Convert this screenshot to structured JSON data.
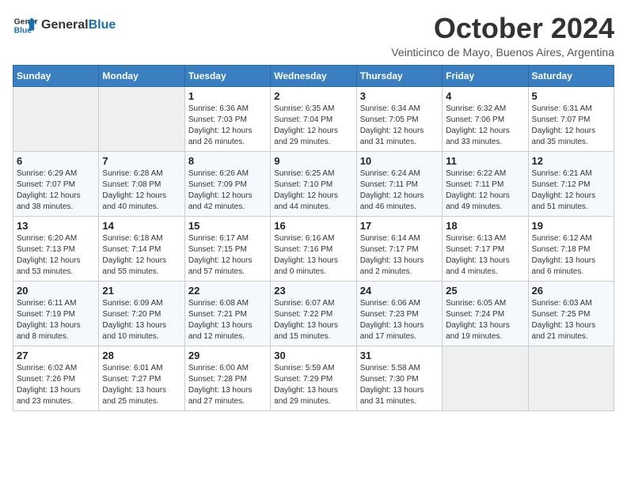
{
  "header": {
    "logo_general": "General",
    "logo_blue": "Blue",
    "month_title": "October 2024",
    "subtitle": "Veinticinco de Mayo, Buenos Aires, Argentina"
  },
  "days_of_week": [
    "Sunday",
    "Monday",
    "Tuesday",
    "Wednesday",
    "Thursday",
    "Friday",
    "Saturday"
  ],
  "weeks": [
    [
      {
        "day": "",
        "empty": true
      },
      {
        "day": "",
        "empty": true
      },
      {
        "day": "1",
        "sunrise": "6:36 AM",
        "sunset": "7:03 PM",
        "daylight": "12 hours and 26 minutes."
      },
      {
        "day": "2",
        "sunrise": "6:35 AM",
        "sunset": "7:04 PM",
        "daylight": "12 hours and 29 minutes."
      },
      {
        "day": "3",
        "sunrise": "6:34 AM",
        "sunset": "7:05 PM",
        "daylight": "12 hours and 31 minutes."
      },
      {
        "day": "4",
        "sunrise": "6:32 AM",
        "sunset": "7:06 PM",
        "daylight": "12 hours and 33 minutes."
      },
      {
        "day": "5",
        "sunrise": "6:31 AM",
        "sunset": "7:07 PM",
        "daylight": "12 hours and 35 minutes."
      }
    ],
    [
      {
        "day": "6",
        "sunrise": "6:29 AM",
        "sunset": "7:07 PM",
        "daylight": "12 hours and 38 minutes."
      },
      {
        "day": "7",
        "sunrise": "6:28 AM",
        "sunset": "7:08 PM",
        "daylight": "12 hours and 40 minutes."
      },
      {
        "day": "8",
        "sunrise": "6:26 AM",
        "sunset": "7:09 PM",
        "daylight": "12 hours and 42 minutes."
      },
      {
        "day": "9",
        "sunrise": "6:25 AM",
        "sunset": "7:10 PM",
        "daylight": "12 hours and 44 minutes."
      },
      {
        "day": "10",
        "sunrise": "6:24 AM",
        "sunset": "7:11 PM",
        "daylight": "12 hours and 46 minutes."
      },
      {
        "day": "11",
        "sunrise": "6:22 AM",
        "sunset": "7:11 PM",
        "daylight": "12 hours and 49 minutes."
      },
      {
        "day": "12",
        "sunrise": "6:21 AM",
        "sunset": "7:12 PM",
        "daylight": "12 hours and 51 minutes."
      }
    ],
    [
      {
        "day": "13",
        "sunrise": "6:20 AM",
        "sunset": "7:13 PM",
        "daylight": "12 hours and 53 minutes."
      },
      {
        "day": "14",
        "sunrise": "6:18 AM",
        "sunset": "7:14 PM",
        "daylight": "12 hours and 55 minutes."
      },
      {
        "day": "15",
        "sunrise": "6:17 AM",
        "sunset": "7:15 PM",
        "daylight": "12 hours and 57 minutes."
      },
      {
        "day": "16",
        "sunrise": "6:16 AM",
        "sunset": "7:16 PM",
        "daylight": "13 hours and 0 minutes."
      },
      {
        "day": "17",
        "sunrise": "6:14 AM",
        "sunset": "7:17 PM",
        "daylight": "13 hours and 2 minutes."
      },
      {
        "day": "18",
        "sunrise": "6:13 AM",
        "sunset": "7:17 PM",
        "daylight": "13 hours and 4 minutes."
      },
      {
        "day": "19",
        "sunrise": "6:12 AM",
        "sunset": "7:18 PM",
        "daylight": "13 hours and 6 minutes."
      }
    ],
    [
      {
        "day": "20",
        "sunrise": "6:11 AM",
        "sunset": "7:19 PM",
        "daylight": "13 hours and 8 minutes."
      },
      {
        "day": "21",
        "sunrise": "6:09 AM",
        "sunset": "7:20 PM",
        "daylight": "13 hours and 10 minutes."
      },
      {
        "day": "22",
        "sunrise": "6:08 AM",
        "sunset": "7:21 PM",
        "daylight": "13 hours and 12 minutes."
      },
      {
        "day": "23",
        "sunrise": "6:07 AM",
        "sunset": "7:22 PM",
        "daylight": "13 hours and 15 minutes."
      },
      {
        "day": "24",
        "sunrise": "6:06 AM",
        "sunset": "7:23 PM",
        "daylight": "13 hours and 17 minutes."
      },
      {
        "day": "25",
        "sunrise": "6:05 AM",
        "sunset": "7:24 PM",
        "daylight": "13 hours and 19 minutes."
      },
      {
        "day": "26",
        "sunrise": "6:03 AM",
        "sunset": "7:25 PM",
        "daylight": "13 hours and 21 minutes."
      }
    ],
    [
      {
        "day": "27",
        "sunrise": "6:02 AM",
        "sunset": "7:26 PM",
        "daylight": "13 hours and 23 minutes."
      },
      {
        "day": "28",
        "sunrise": "6:01 AM",
        "sunset": "7:27 PM",
        "daylight": "13 hours and 25 minutes."
      },
      {
        "day": "29",
        "sunrise": "6:00 AM",
        "sunset": "7:28 PM",
        "daylight": "13 hours and 27 minutes."
      },
      {
        "day": "30",
        "sunrise": "5:59 AM",
        "sunset": "7:29 PM",
        "daylight": "13 hours and 29 minutes."
      },
      {
        "day": "31",
        "sunrise": "5:58 AM",
        "sunset": "7:30 PM",
        "daylight": "13 hours and 31 minutes."
      },
      {
        "day": "",
        "empty": true
      },
      {
        "day": "",
        "empty": true
      }
    ]
  ]
}
